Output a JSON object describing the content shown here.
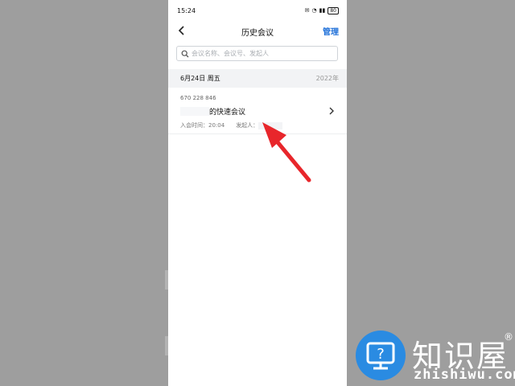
{
  "status_bar": {
    "time": "15:24",
    "battery": "80"
  },
  "nav": {
    "title": "历史会议",
    "manage_label": "管理"
  },
  "search": {
    "placeholder": "会议名称、会议号、发起人"
  },
  "section": {
    "date": "6月24日 周五",
    "year": "2022年"
  },
  "meeting": {
    "id": "670 228 846",
    "name_suffix": "的快速会议",
    "join_time": "入会时间：20:04",
    "initiator_label": "发起人："
  },
  "watermark": {
    "brand": "知识屋",
    "reg": "®",
    "domain": "zhishiwu.com"
  },
  "colors": {
    "accent": "#1e6fd8",
    "arrow": "#e8262b",
    "watermark_circle": "#2a8be2"
  },
  "icons": [
    "back-arrow-icon",
    "search-icon",
    "chevron-right-icon",
    "signal-icon",
    "wifi-icon",
    "battery-icon",
    "red-pointer-arrow"
  ]
}
